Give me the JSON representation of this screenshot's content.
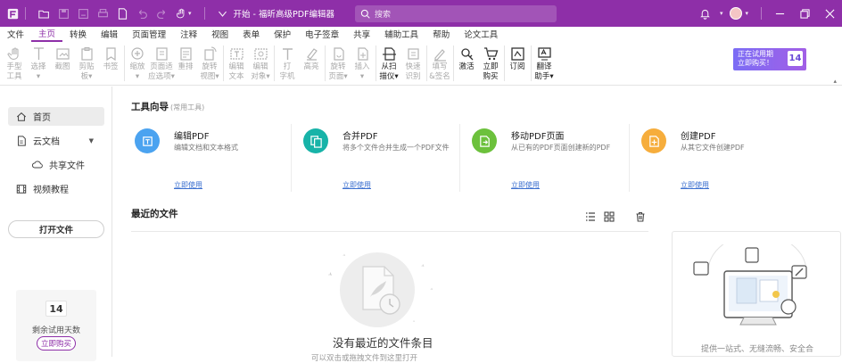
{
  "titlebar": {
    "app_title": "开始 - 福昕高级PDF编辑器",
    "search_placeholder": "搜索"
  },
  "menu": {
    "items": [
      "文件",
      "主页",
      "转换",
      "编辑",
      "页面管理",
      "注释",
      "视图",
      "表单",
      "保护",
      "电子签章",
      "共享",
      "辅助工具",
      "帮助",
      "论文工具"
    ],
    "active_index": 1
  },
  "ribbon": {
    "groups": [
      [
        {
          "label": "手型\n工具",
          "icon": "hand-icon",
          "enabled": false
        },
        {
          "label": "选择\n▾",
          "icon": "select-icon",
          "enabled": false
        },
        {
          "label": "截图",
          "icon": "screenshot-icon",
          "enabled": false
        },
        {
          "label": "剪贴\n板▾",
          "icon": "clipboard-icon",
          "enabled": false
        },
        {
          "label": "书签",
          "icon": "bookmark-icon",
          "enabled": false
        }
      ],
      [
        {
          "label": "缩放\n▾",
          "icon": "zoom-icon",
          "enabled": false
        },
        {
          "label": "页面适\n应选项▾",
          "icon": "fit-page-icon",
          "enabled": false
        },
        {
          "label": "重排",
          "icon": "reflow-icon",
          "enabled": false
        },
        {
          "label": "旋转\n视图▾",
          "icon": "rotate-view-icon",
          "enabled": false
        }
      ],
      [
        {
          "label": "编辑\n文本",
          "icon": "edit-text-icon",
          "enabled": false
        },
        {
          "label": "编辑\n对象▾",
          "icon": "edit-object-icon",
          "enabled": false
        }
      ],
      [
        {
          "label": "打\n字机",
          "icon": "typewriter-icon",
          "enabled": false
        },
        {
          "label": "高亮",
          "icon": "highlight-icon",
          "enabled": false
        }
      ],
      [
        {
          "label": "旋转\n页面▾",
          "icon": "rotate-page-icon",
          "enabled": false
        },
        {
          "label": "插入\n▾",
          "icon": "insert-icon",
          "enabled": false
        }
      ],
      [
        {
          "label": "从扫\n描仪▾",
          "icon": "scanner-icon",
          "enabled": true
        },
        {
          "label": "快速\n识别",
          "icon": "ocr-icon",
          "enabled": false
        }
      ],
      [
        {
          "label": "填写\n&签名",
          "icon": "fill-sign-icon",
          "enabled": false
        }
      ],
      [
        {
          "label": "激活",
          "icon": "activate-icon",
          "enabled": true
        },
        {
          "label": "立即\n购买",
          "icon": "cart-icon",
          "enabled": true
        }
      ],
      [
        {
          "label": "订阅",
          "icon": "subscribe-icon",
          "enabled": true
        }
      ],
      [
        {
          "label": "翻译\n助手▾",
          "icon": "translate-icon",
          "enabled": true
        }
      ]
    ],
    "promo": {
      "line1": "正在试用期",
      "line2": "立即购买！",
      "days": "14"
    }
  },
  "sidebar": {
    "items": [
      {
        "label": "首页",
        "icon": "home-icon"
      },
      {
        "label": "云文档",
        "icon": "cloud-doc-icon"
      },
      {
        "label": "共享文件",
        "icon": "shared-file-icon"
      },
      {
        "label": "视频教程",
        "icon": "video-icon"
      }
    ],
    "open_file": "打开文件",
    "trial": {
      "days": "14",
      "label": "剩余试用天数",
      "buy": "立即购买"
    }
  },
  "main": {
    "tools_title": "工具向导",
    "tools_subtitle": "(常用工具)",
    "tools": [
      {
        "title": "编辑PDF",
        "desc": "编辑文档和文本格式",
        "link": "立即使用",
        "color": "#4ba3f0",
        "icon": "edit-pdf-icon"
      },
      {
        "title": "合并PDF",
        "desc": "将多个文件合并生成一个PDF文件",
        "link": "立即使用",
        "color": "#17b3a8",
        "icon": "merge-pdf-icon"
      },
      {
        "title": "移动PDF页面",
        "desc": "从已有的PDF页面创建新的PDF",
        "link": "立即使用",
        "color": "#6cc13c",
        "icon": "move-pages-icon"
      },
      {
        "title": "创建PDF",
        "desc": "从其它文件创建PDF",
        "link": "立即使用",
        "color": "#f6ad3c",
        "icon": "create-pdf-icon"
      }
    ],
    "recent_title": "最近的文件",
    "empty_text": "没有最近的文件条目",
    "empty_sub": "可以双击或拖拽文件到这里打开",
    "right_panel_text": "提供一站式、无缝流畅、安全合"
  }
}
